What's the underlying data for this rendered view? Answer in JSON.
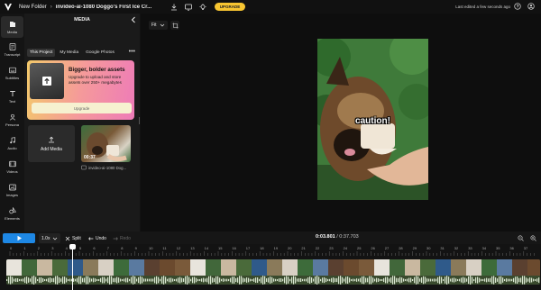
{
  "topbar": {
    "folder": "New Folder",
    "separator": "›",
    "title": "invideo-ai-1080 Doggo's First Ice Cr...",
    "upgrade_label": "UPGRADE",
    "edited_text": "Last edited a few seconds ago",
    "upgrade_color": "#f7c531"
  },
  "nav": {
    "items": [
      {
        "label": "Media",
        "icon": "media-icon"
      },
      {
        "label": "Transcript",
        "icon": "transcript-icon"
      },
      {
        "label": "Subtitles",
        "icon": "subtitles-icon"
      },
      {
        "label": "Text",
        "icon": "text-icon"
      },
      {
        "label": "Persona",
        "icon": "persona-icon"
      },
      {
        "label": "Audio",
        "icon": "audio-icon"
      },
      {
        "label": "Videos",
        "icon": "videos-icon"
      },
      {
        "label": "Images",
        "icon": "images-icon"
      },
      {
        "label": "Elements",
        "icon": "elements-icon"
      }
    ]
  },
  "panel": {
    "title": "MEDIA",
    "tabs": [
      "This Project",
      "My Media",
      "Google Photos"
    ],
    "more": "•••",
    "promo": {
      "heading": "Bigger, bolder assets",
      "text": "Upgrade to upload and store assets over 250+ megabytes",
      "button": "Upgrade"
    },
    "add_media_label": "Add Media",
    "asset": {
      "duration": "00:37",
      "name": "invideo-ai-1080 Dog..."
    }
  },
  "preview": {
    "fit_label": "Fit",
    "caption": "caution!"
  },
  "controls": {
    "speed": "1.0x",
    "split": "Split",
    "undo": "Undo",
    "redo": "Redo",
    "time_current": "0:03.801",
    "time_total": "/ 0:37.703",
    "accent": "#1e88e5"
  },
  "ruler": {
    "labels": [
      "0",
      "1",
      "2",
      "3",
      "4",
      "5",
      "6",
      "7",
      "8",
      "9",
      "10",
      "11",
      "12",
      "13",
      "14",
      "15",
      "16",
      "17",
      "18",
      "19",
      "20",
      "21",
      "22",
      "23",
      "24",
      "25",
      "26",
      "27",
      "28",
      "29",
      "30",
      "31",
      "32",
      "33",
      "34",
      "35",
      "36",
      "37"
    ]
  }
}
